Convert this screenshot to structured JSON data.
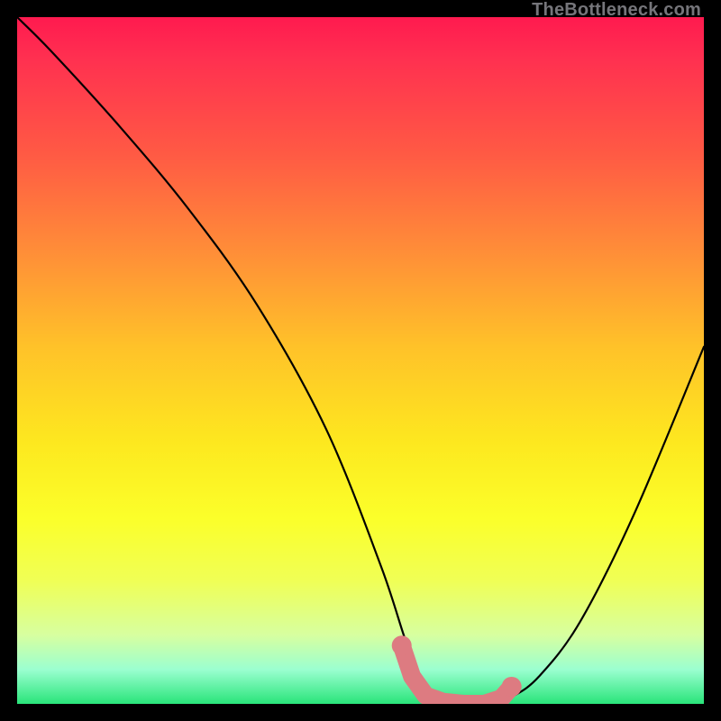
{
  "watermark": "TheBottleneck.com",
  "chart_data": {
    "type": "line",
    "title": "",
    "xlabel": "",
    "ylabel": "",
    "xlim": [
      0,
      100
    ],
    "ylim": [
      0,
      100
    ],
    "series": [
      {
        "name": "bottleneck-curve",
        "x": [
          0,
          5,
          15,
          25,
          35,
          45,
          53,
          57,
          60,
          63,
          66,
          69,
          72,
          76,
          82,
          90,
          100
        ],
        "values": [
          100,
          95,
          84,
          72,
          58,
          40,
          20,
          8,
          2,
          0,
          0,
          0,
          1,
          4,
          12,
          28,
          52
        ]
      }
    ],
    "markers": {
      "name": "highlight-band",
      "color": "#dd7b81",
      "x": [
        56.0,
        57.5,
        59.5,
        62.0,
        65.0,
        68.0,
        70.5,
        72.0
      ],
      "values": [
        8.5,
        4.0,
        1.2,
        0.3,
        0.0,
        0.0,
        0.8,
        2.5
      ]
    }
  }
}
